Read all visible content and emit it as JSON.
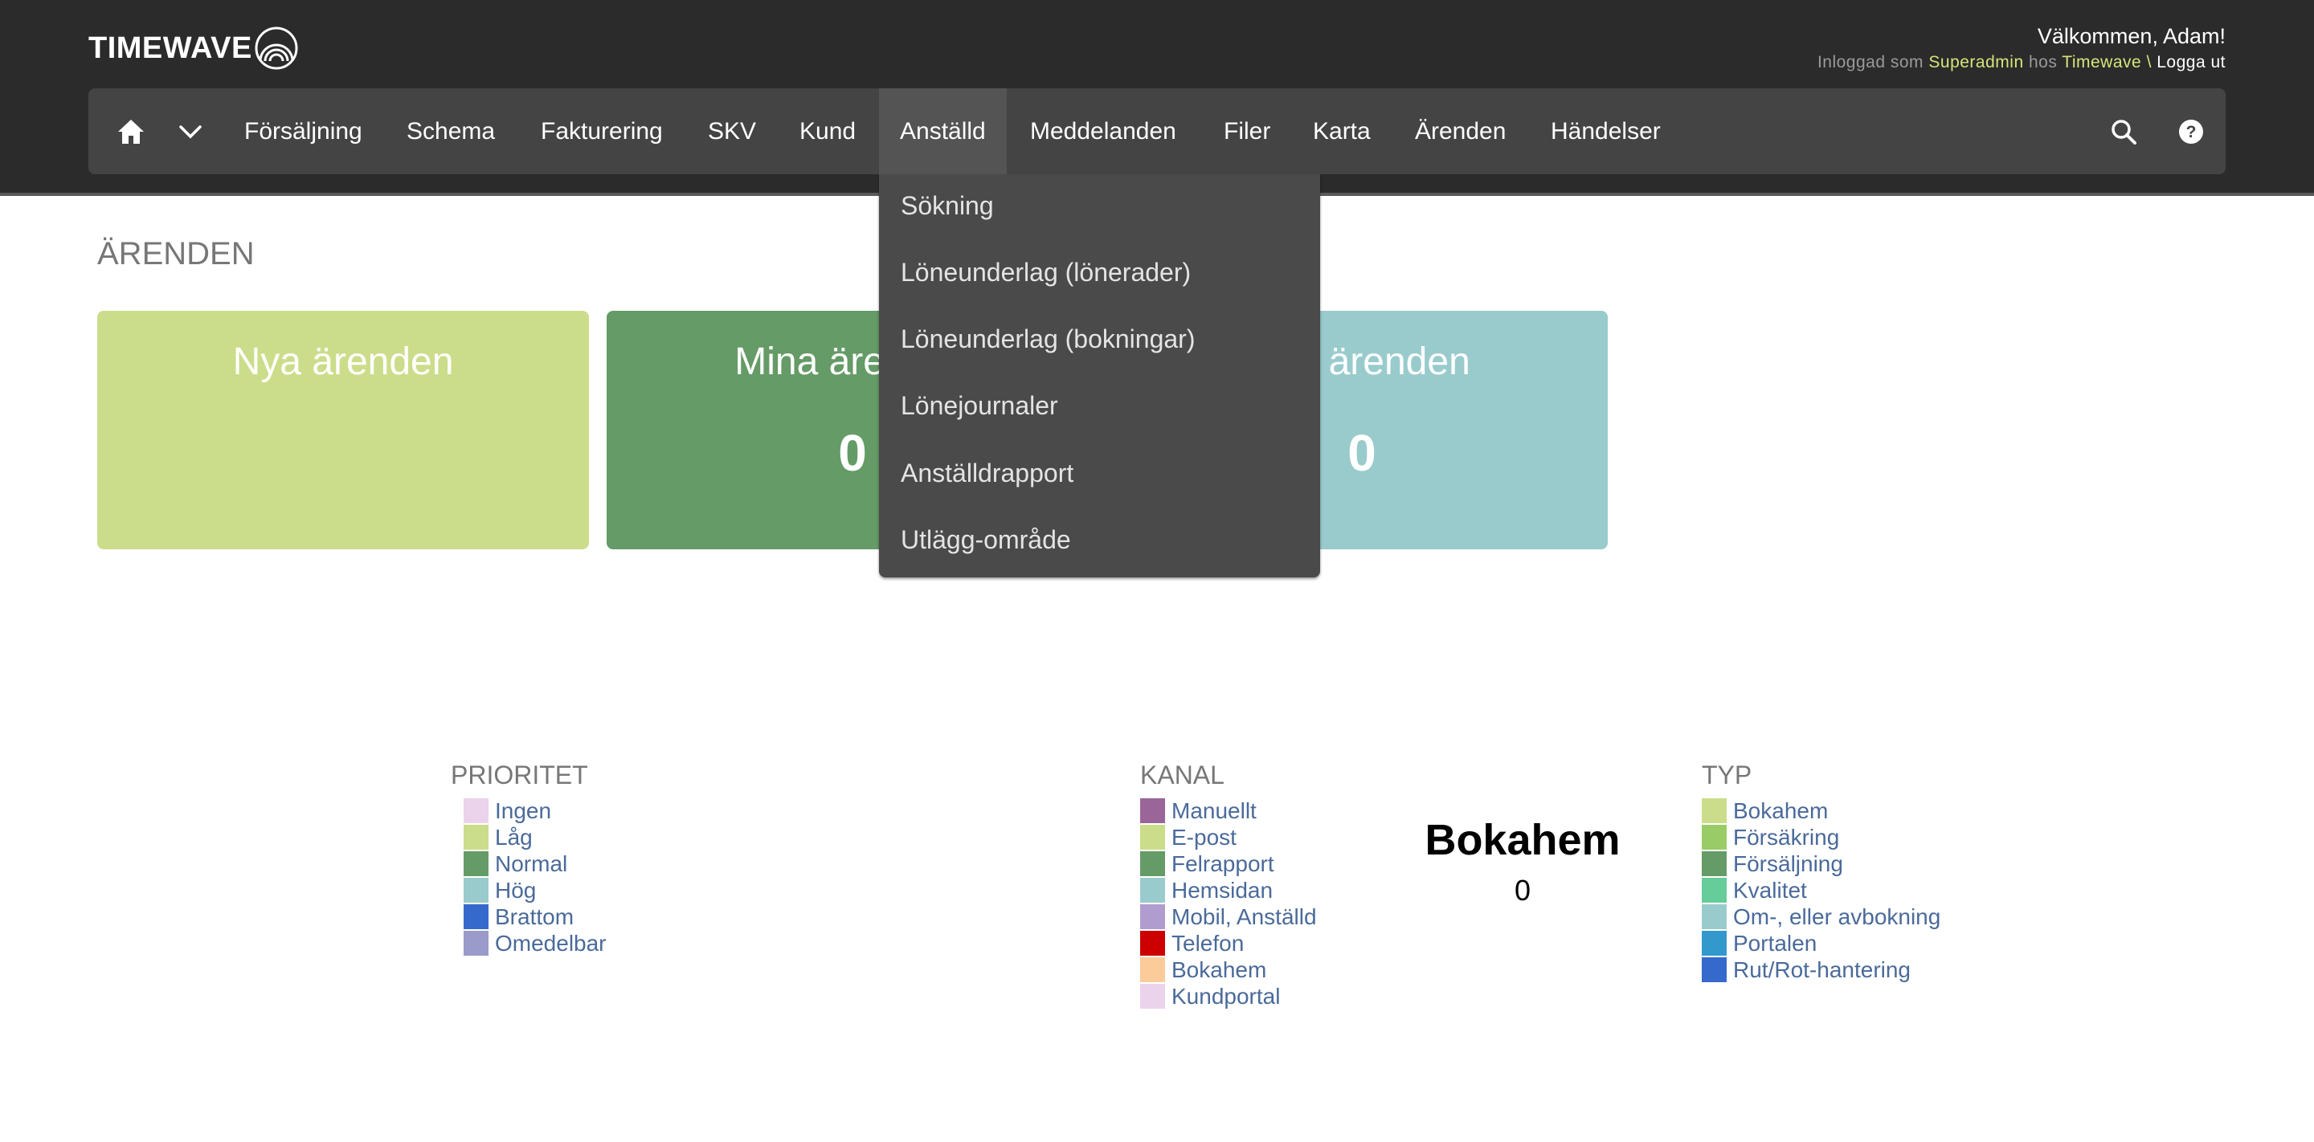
{
  "header": {
    "logo_text": "TIMEWAVE",
    "welcome": "Välkommen, Adam!",
    "logged_in_prefix": "Inloggad som",
    "role": "Superadmin",
    "at": "hos",
    "company": "Timewave",
    "separator": "\\",
    "logout": "Logga ut"
  },
  "nav": {
    "home_icon": "home-icon",
    "expand_icon": "chevron-down-icon",
    "items": [
      "Försäljning",
      "Schema",
      "Fakturering",
      "SKV",
      "Kund",
      "Anställd",
      "Meddelanden",
      "Filer",
      "Karta",
      "Ärenden",
      "Händelser"
    ],
    "active": "Anställd",
    "search_icon": "search-icon",
    "help_icon": "help-icon"
  },
  "dropdown": {
    "items": [
      "Sökning",
      "Löneunderlag (lönerader)",
      "Löneunderlag (bokningar)",
      "Lönejournaler",
      "Anställdrapport",
      "Utlägg-område"
    ]
  },
  "page": {
    "title": "ÄRENDEN"
  },
  "cards": [
    {
      "title": "Nya ärenden",
      "count": "",
      "color": "#cbdd8a"
    },
    {
      "title": "Mina ärenden",
      "count": "0",
      "color": "#659b66"
    },
    {
      "title": "Alla ärenden",
      "count": "0",
      "color": "#99cbcc"
    }
  ],
  "legends": {
    "priority": {
      "title": "PRIORITET",
      "items": [
        {
          "label": "Ingen",
          "color": "#ecd3ec"
        },
        {
          "label": "Låg",
          "color": "#cbdd8a"
        },
        {
          "label": "Normal",
          "color": "#659b66"
        },
        {
          "label": "Hög",
          "color": "#99cbcc"
        },
        {
          "label": "Brattom",
          "color": "#3569cc"
        },
        {
          "label": "Omedelbar",
          "color": "#9a9acb"
        }
      ]
    },
    "channel": {
      "title": "KANAL",
      "items": [
        {
          "label": "Manuellt",
          "color": "#9a6699"
        },
        {
          "label": "E-post",
          "color": "#cbdd8a"
        },
        {
          "label": "Felrapport",
          "color": "#659b66"
        },
        {
          "label": "Hemsidan",
          "color": "#99cbcc"
        },
        {
          "label": "Mobil, Anställd",
          "color": "#b19cd0"
        },
        {
          "label": "Telefon",
          "color": "#cc0000"
        },
        {
          "label": "Bokahem",
          "color": "#fccb9a"
        },
        {
          "label": "Kundportal",
          "color": "#ecd3ec"
        }
      ]
    },
    "type": {
      "title": "TYP",
      "items": [
        {
          "label": "Bokahem",
          "color": "#cbdd8a"
        },
        {
          "label": "Försäkring",
          "color": "#99cc66"
        },
        {
          "label": "Försäljning",
          "color": "#659b66"
        },
        {
          "label": "Kvalitet",
          "color": "#66cc99"
        },
        {
          "label": "Om-, eller avbokning",
          "color": "#99cbcc"
        },
        {
          "label": "Portalen",
          "color": "#3399cc"
        },
        {
          "label": "Rut/Rot-hantering",
          "color": "#3569cc"
        }
      ]
    }
  },
  "chart_center": {
    "label": "Bokahem",
    "value": "0"
  }
}
